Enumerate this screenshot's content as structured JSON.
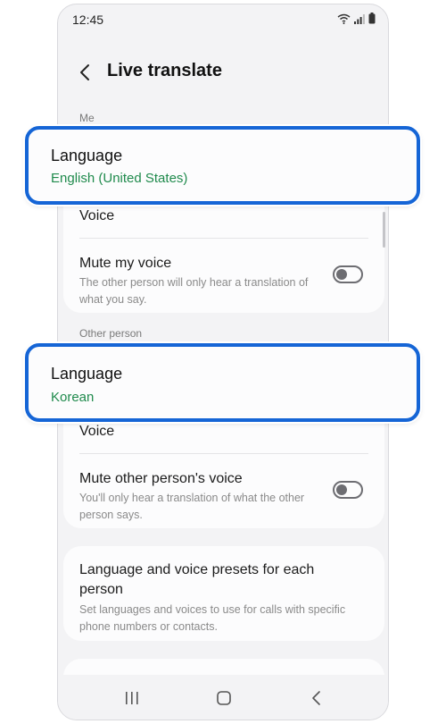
{
  "status_bar": {
    "time": "12:45"
  },
  "header": {
    "title": "Live translate"
  },
  "me": {
    "section_label": "Me",
    "language": {
      "label": "Language",
      "value": "English (United States)"
    },
    "voice": {
      "label": "Voice"
    },
    "mute": {
      "label": "Mute my voice",
      "description": "The other person will only hear a translation of what you say.",
      "enabled": false
    }
  },
  "other": {
    "section_label": "Other person",
    "language": {
      "label": "Language",
      "value": "Korean"
    },
    "voice": {
      "label": "Voice"
    },
    "mute": {
      "label": "Mute other person's voice",
      "description": "You'll only hear a translation of what the other person says.",
      "enabled": false
    }
  },
  "presets": {
    "label": "Language and voice presets for each person",
    "description": "Set languages and voices to use for calls with specific phone numbers or contacts."
  },
  "colors": {
    "accent": "#1565d6",
    "value_green": "#1f8a4c",
    "background": "#f3f3f5",
    "card": "#fcfcfd"
  },
  "icons": {
    "back": "chevron-left-icon",
    "nav_recents": "recents-icon",
    "nav_home": "home-icon",
    "nav_back": "back-icon"
  }
}
